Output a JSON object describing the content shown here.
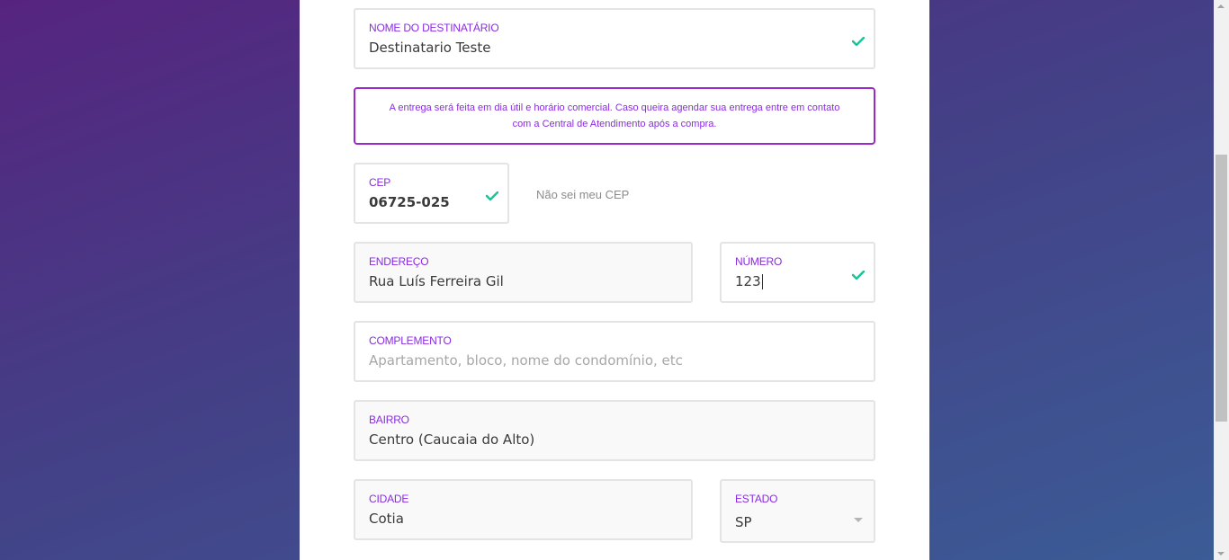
{
  "form": {
    "recipient": {
      "label": "NOME DO DESTINATÁRIO",
      "value": "Destinatario Teste",
      "valid": true
    },
    "notice": "A entrega será feita em dia útil e horário comercial. Caso queira agendar sua entrega entre em contato com a Central de Atendimento após a compra.",
    "cep": {
      "label": "CEP",
      "value": "06725-025",
      "valid": true
    },
    "cep_link": "Não sei meu CEP",
    "address": {
      "label": "ENDEREÇO",
      "value": "Rua Luís Ferreira Gil"
    },
    "number": {
      "label": "NÚMERO",
      "value": "123",
      "valid": true
    },
    "complement": {
      "label": "COMPLEMENTO",
      "placeholder": "Apartamento, bloco, nome do condomínio, etc"
    },
    "neighborhood": {
      "label": "BAIRRO",
      "value": "Centro (Caucaia do Alto)"
    },
    "city": {
      "label": "CIDADE",
      "value": "Cotia"
    },
    "state": {
      "label": "ESTADO",
      "value": "SP"
    }
  },
  "colors": {
    "accent": "#8a2be2",
    "notice_border": "#9b29c9",
    "check": "#1fc39b"
  },
  "icons": {
    "valid": "check-icon",
    "dropdown": "chevron-down-icon"
  }
}
